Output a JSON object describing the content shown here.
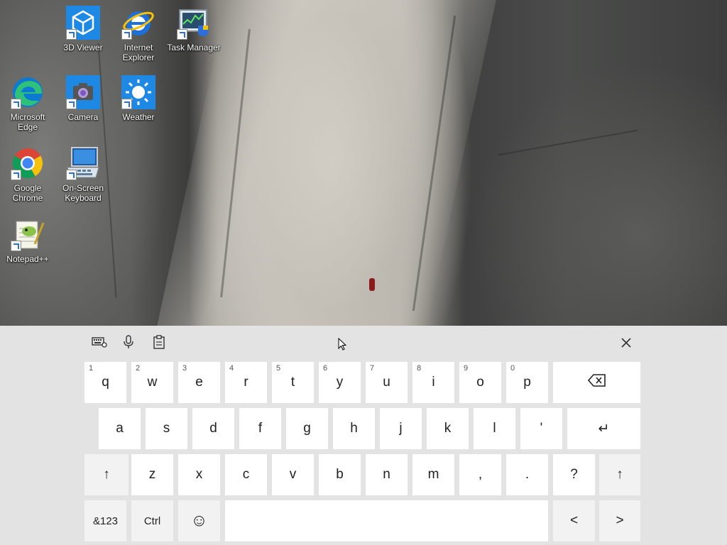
{
  "desktop": {
    "icons": [
      {
        "label": "3D Viewer",
        "icon": "3d-viewer-icon"
      },
      {
        "label": "Internet Explorer",
        "icon": "internet-explorer-icon"
      },
      {
        "label": "Task Manager",
        "icon": "task-manager-icon"
      },
      {
        "label": "Microsoft Edge",
        "icon": "edge-icon"
      },
      {
        "label": "Camera",
        "icon": "camera-icon"
      },
      {
        "label": "Weather",
        "icon": "weather-icon"
      },
      {
        "label": "Google Chrome",
        "icon": "chrome-icon"
      },
      {
        "label": "On-Screen Keyboard",
        "icon": "on-screen-keyboard-icon"
      },
      {
        "label": "Notepad++",
        "icon": "notepadpp-icon"
      }
    ]
  },
  "keyboard": {
    "toolbar": {
      "settings_icon": "keyboard-settings-icon",
      "mic_icon": "microphone-icon",
      "clipboard_icon": "clipboard-icon",
      "close_icon": "close-icon"
    },
    "row1": [
      {
        "label": "q",
        "num": "1"
      },
      {
        "label": "w",
        "num": "2"
      },
      {
        "label": "e",
        "num": "3"
      },
      {
        "label": "r",
        "num": "4"
      },
      {
        "label": "t",
        "num": "5"
      },
      {
        "label": "y",
        "num": "6"
      },
      {
        "label": "u",
        "num": "7"
      },
      {
        "label": "i",
        "num": "8"
      },
      {
        "label": "o",
        "num": "9"
      },
      {
        "label": "p",
        "num": "0"
      }
    ],
    "backspace": "⌫",
    "row2": [
      "a",
      "s",
      "d",
      "f",
      "g",
      "h",
      "j",
      "k",
      "l",
      "'"
    ],
    "enter": "↵",
    "shift": "↑",
    "row3": [
      "z",
      "x",
      "c",
      "v",
      "b",
      "n",
      "m",
      ",",
      ".",
      "?"
    ],
    "symbols": "&123",
    "ctrl": "Ctrl",
    "emoji": "☺",
    "space": "",
    "left": "<",
    "right": ">"
  },
  "colors": {
    "keyboard_bg": "#e3e3e3",
    "key_bg": "#ffffff",
    "key_special_bg": "#f2f2f2"
  }
}
